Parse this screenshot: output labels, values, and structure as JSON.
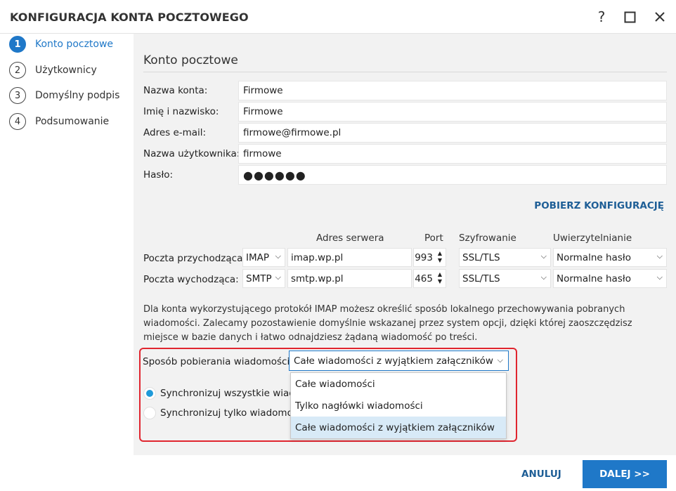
{
  "window": {
    "title": "KONFIGURACJA KONTA POCZTOWEGO",
    "help": "?",
    "maximize": "☐",
    "close": "✕"
  },
  "steps": [
    {
      "num": "1",
      "label": "Konto pocztowe"
    },
    {
      "num": "2",
      "label": "Użytkownicy"
    },
    {
      "num": "3",
      "label": "Domyślny podpis"
    },
    {
      "num": "4",
      "label": "Podsumowanie"
    }
  ],
  "section": {
    "title": "Konto pocztowe"
  },
  "form": {
    "account_name_label": "Nazwa konta:",
    "account_name_value": "Firmowe",
    "full_name_label": "Imię i nazwisko:",
    "full_name_value": "Firmowe",
    "email_label": "Adres e-mail:",
    "email_value": "firmowe@firmowe.pl",
    "username_label": "Nazwa użytkownika:",
    "username_value": "firmowe",
    "password_label": "Hasło:",
    "password_value": "●●●●●●"
  },
  "fetch_config": "POBIERZ KONFIGURACJĘ",
  "server": {
    "headers": {
      "address": "Adres serwera",
      "port": "Port",
      "encryption": "Szyfrowanie",
      "auth": "Uwierzytelnianie"
    },
    "incoming": {
      "label": "Poczta przychodząca:",
      "protocol": "IMAP",
      "address": "imap.wp.pl",
      "port": "993",
      "encryption": "SSL/TLS",
      "auth": "Normalne hasło"
    },
    "outgoing": {
      "label": "Poczta wychodząca:",
      "protocol": "SMTP",
      "address": "smtp.wp.pl",
      "port": "465",
      "encryption": "SSL/TLS",
      "auth": "Normalne hasło"
    }
  },
  "info_text": "Dla konta wykorzystującego protokół IMAP możesz określić sposób lokalnego przechowywania pobranych wiadomości. Zalecamy pozostawienie domyślnie wskazanej przez system opcji, dzięki której zaoszczędzisz miejsce w bazie danych i łatwo odnajdziesz żądaną wiadomość po treści.",
  "method": {
    "label": "Sposób pobierania wiadomości:",
    "selected": "Całe wiadomości z wyjątkiem załączników",
    "options": [
      "Całe wiadomości",
      "Tylko nagłówki wiadomości",
      "Całe wiadomości z wyjątkiem załączników"
    ]
  },
  "sync": {
    "all_label": "Synchronizuj wszystkie wiadomości",
    "only_label": "Synchronizuj tylko wiadomości"
  },
  "footer": {
    "cancel": "ANULUJ",
    "next": "DALEJ >>"
  },
  "colors": {
    "accent": "#1f78c8",
    "link": "#1e5e96",
    "highlight": "#e0252f"
  }
}
